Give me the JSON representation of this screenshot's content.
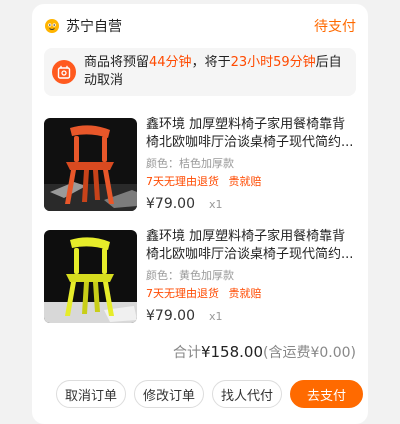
{
  "store": {
    "name": "苏宁自营",
    "status": "待支付",
    "icon": "bee-icon"
  },
  "notice": {
    "prefix": "商品将预留",
    "reserve": "44分钟",
    "middle": "，将于",
    "deadline": "23小时59分钟",
    "suffix": "后自动取消"
  },
  "items": [
    {
      "title": "鑫环境 加厚塑料椅子家用餐椅靠背椅北欧咖啡厅洽谈桌椅子现代简约...",
      "spec": "颜色：桔色加厚款",
      "badge1": "7天无理由退货",
      "badge2": "贵就赔",
      "price": "¥79.00",
      "qty": "x1",
      "color": "#e8572a"
    },
    {
      "title": "鑫环境 加厚塑料椅子家用餐椅靠背椅北欧咖啡厅洽谈桌椅子现代简约...",
      "spec": "颜色：黄色加厚款",
      "badge1": "7天无理由退货",
      "badge2": "贵就赔",
      "price": "¥79.00",
      "qty": "x1",
      "color": "#e6ec2a"
    }
  ],
  "summary": {
    "label": "合计",
    "amount": "¥158.00",
    "shipping": "(含运费¥0.00)"
  },
  "actions": {
    "cancel": "取消订单",
    "modify": "修改订单",
    "proxy": "找人代付",
    "pay": "去支付"
  },
  "colors": {
    "accent": "#ff6a00",
    "highlight": "#ff4a00"
  }
}
